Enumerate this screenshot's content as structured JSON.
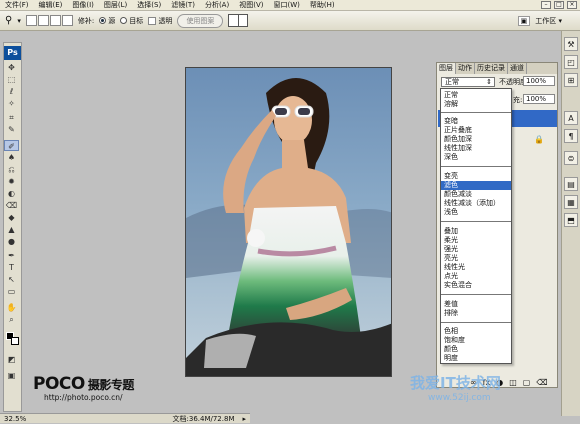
{
  "menubar": {
    "items": [
      "文件(F)",
      "编辑(E)",
      "图像(I)",
      "图层(L)",
      "选择(S)",
      "滤镜(T)",
      "分析(A)",
      "视图(V)",
      "窗口(W)",
      "帮助(H)"
    ]
  },
  "optionsbar": {
    "feather_label": "修补:",
    "source_label": "源",
    "target_label": "目标",
    "transparent_label": "透明",
    "use_pattern_label": "使用图案",
    "workspace_label": "工作区 ▾"
  },
  "toolbox": {
    "logo": "Ps",
    "tools": [
      "✥",
      "⬚",
      "ℓ",
      "✧",
      "⌗",
      "✎",
      "✐",
      "♠",
      "⎌",
      "✹",
      "◐",
      "⌫",
      "◆",
      "▲",
      "●",
      "✒",
      "T",
      "↖",
      "▭",
      "✋",
      "⌕",
      "◩",
      "▣"
    ]
  },
  "righttools": [
    "⚒",
    "◰",
    "⊞",
    "A",
    "¶",
    "⊜",
    "▤",
    "▦",
    "⬒"
  ],
  "panel": {
    "tabs": [
      "图层",
      "动作",
      "历史记录",
      "通道"
    ],
    "blend_mode": "正常",
    "opacity_label": "不透明度:",
    "opacity_value": "100%",
    "fill_label": "充:",
    "fill_value": "100%",
    "lock_icon": "🔒",
    "bottom_icons": [
      "∞",
      "fx",
      "◑",
      "◫",
      "▢",
      "⌫"
    ]
  },
  "blend_dropdown": {
    "groups": [
      [
        "正常",
        "溶解"
      ],
      [
        "变暗",
        "正片叠底",
        "颜色加深",
        "线性加深",
        "深色"
      ],
      [
        "变亮",
        "滤色",
        "颜色减淡",
        "线性减淡（添加）",
        "浅色"
      ],
      [
        "叠加",
        "柔光",
        "强光",
        "亮光",
        "线性光",
        "点光",
        "实色混合"
      ],
      [
        "差值",
        "排除"
      ],
      [
        "色相",
        "饱和度",
        "颜色",
        "明度"
      ]
    ],
    "selected": "滤色"
  },
  "status": {
    "zoom": "32.5%",
    "doc": "文档:36.4M/72.8M"
  },
  "watermark": {
    "brand": "POCO",
    "brand_sub": "摄影专题",
    "url": "http://photo.poco.cn/",
    "site": "我爱IT技术网",
    "site_url": "www.52ij.com"
  }
}
